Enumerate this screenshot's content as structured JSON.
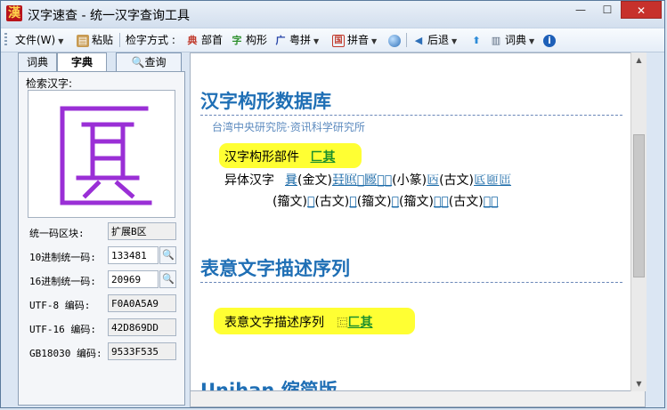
{
  "window": {
    "title": "汉字速查 - 统一汉字查询工具",
    "app_icon": "漢",
    "minimize_glyph": "—",
    "maximize_glyph": "☐",
    "close_glyph": "✕"
  },
  "toolbar": {
    "file": "文件(W)",
    "paste": "粘贴",
    "mode_label": "检字方式 :",
    "radical": "部首",
    "shape": "构形",
    "cantonese": "粤拼",
    "pinyin": "拼音",
    "back": "后退",
    "dictionary": "词典"
  },
  "left": {
    "tabs": [
      "词典",
      "字典",
      "查询"
    ],
    "search_label": "检索汉字:",
    "glyph_color": "#9a2fd6",
    "fields": [
      {
        "label": "统一码区块:",
        "value": "扩展B区"
      },
      {
        "label": "10进制统一码:",
        "value": "133481"
      },
      {
        "label": "16进制统一码:",
        "value": "20969"
      },
      {
        "label": "UTF-8  编码:",
        "value": "F0A0A5A9"
      },
      {
        "label": "UTF-16  编码:",
        "value": "42D869DD"
      },
      {
        "label": "GB18030 编码:",
        "value": "9533F535"
      }
    ]
  },
  "content": {
    "section1": {
      "title": "汉字构形数据库",
      "source": "台湾中央研究院·资讯科学研究所",
      "parts_label": "汉字构形部件",
      "parts_value": "匚其",
      "variants_label": "异体汉字",
      "variants_line1": [
        {
          "t": "㠱",
          "link": true
        },
        {
          "t": "(金文)",
          "link": false
        },
        {
          "t": "㠭𠥩𠥪𠥫𠥬𠥭",
          "link": true
        },
        {
          "t": "(小篆)",
          "link": false
        },
        {
          "t": "𠥮",
          "link": true
        },
        {
          "t": "(古文)",
          "link": false
        },
        {
          "t": "𠥯𠥰𠥱",
          "link": true
        }
      ],
      "variants_line2": [
        {
          "t": "(籀文)",
          "link": false
        },
        {
          "t": "𠥲",
          "link": true
        },
        {
          "t": "(古文)",
          "link": false
        },
        {
          "t": "𠥳",
          "link": true
        },
        {
          "t": "(籀文)",
          "link": false
        },
        {
          "t": "𠥴",
          "link": true
        },
        {
          "t": "(籀文)",
          "link": false
        },
        {
          "t": "𠥵𠥶",
          "link": true
        },
        {
          "t": "(古文)",
          "link": false
        },
        {
          "t": "𠥷𠥸",
          "link": true
        }
      ]
    },
    "section2": {
      "title": "表意文字描述序列",
      "ids_label": "表意文字描述序列",
      "ids_operator": "⿷",
      "ids_value": "匚其"
    },
    "section3": {
      "title": "Unihan 缩简版"
    }
  }
}
